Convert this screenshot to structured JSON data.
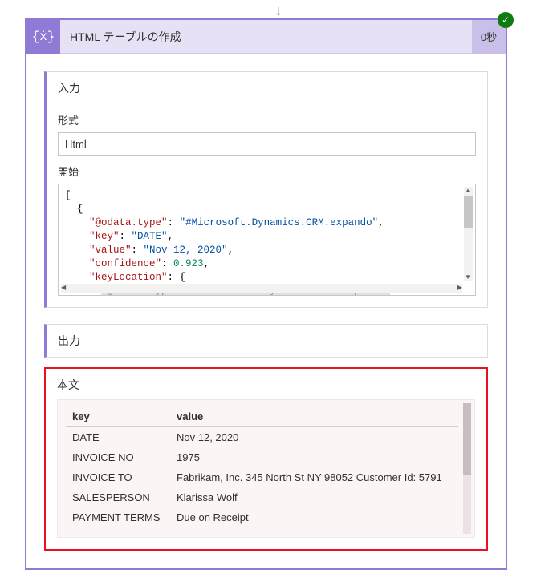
{
  "arrow": "↓",
  "header": {
    "icon_glyph": "{ẋ}",
    "title": "HTML テーブルの作成",
    "duration": "0秒",
    "success_glyph": "✓"
  },
  "input_section": {
    "title": "入力",
    "format_label": "形式",
    "format_value": "Html",
    "start_label": "開始",
    "code_lines": [
      {
        "text": "[",
        "class": "tok-punc"
      },
      {
        "text": "  {",
        "class": "tok-punc"
      },
      {
        "segments": [
          {
            "t": "    ",
            "c": ""
          },
          {
            "t": "\"@odata.type\"",
            "c": "tok-key"
          },
          {
            "t": ": ",
            "c": "tok-punc"
          },
          {
            "t": "\"#Microsoft.Dynamics.CRM.expando\"",
            "c": "tok-str"
          },
          {
            "t": ",",
            "c": "tok-punc"
          }
        ]
      },
      {
        "segments": [
          {
            "t": "    ",
            "c": ""
          },
          {
            "t": "\"key\"",
            "c": "tok-key"
          },
          {
            "t": ": ",
            "c": "tok-punc"
          },
          {
            "t": "\"DATE\"",
            "c": "tok-str"
          },
          {
            "t": ",",
            "c": "tok-punc"
          }
        ]
      },
      {
        "segments": [
          {
            "t": "    ",
            "c": ""
          },
          {
            "t": "\"value\"",
            "c": "tok-key"
          },
          {
            "t": ": ",
            "c": "tok-punc"
          },
          {
            "t": "\"Nov 12, 2020\"",
            "c": "tok-str"
          },
          {
            "t": ",",
            "c": "tok-punc"
          }
        ]
      },
      {
        "segments": [
          {
            "t": "    ",
            "c": ""
          },
          {
            "t": "\"confidence\"",
            "c": "tok-key"
          },
          {
            "t": ": ",
            "c": "tok-punc"
          },
          {
            "t": "0.923",
            "c": "tok-num"
          },
          {
            "t": ",",
            "c": "tok-punc"
          }
        ]
      },
      {
        "segments": [
          {
            "t": "    ",
            "c": ""
          },
          {
            "t": "\"keyLocation\"",
            "c": "tok-key"
          },
          {
            "t": ": {",
            "c": "tok-punc"
          }
        ]
      },
      {
        "segments": [
          {
            "t": "      ",
            "c": ""
          },
          {
            "t": "\"@odata.type\": \"#Microsoft.Dynamics.CRM.expando\"",
            "c": "tok-cut"
          }
        ]
      }
    ]
  },
  "output_section": {
    "title": "出力",
    "body_label": "本文",
    "columns": [
      "key",
      "value"
    ],
    "rows": [
      {
        "key": "DATE",
        "value": "Nov 12, 2020"
      },
      {
        "key": "INVOICE NO",
        "value": "1975"
      },
      {
        "key": "INVOICE TO",
        "value": "Fabrikam, Inc. 345 North St NY 98052 Customer Id: 5791"
      },
      {
        "key": "SALESPERSON",
        "value": "Klarissa Wolf"
      },
      {
        "key": "PAYMENT TERMS",
        "value": "Due on Receipt"
      }
    ]
  }
}
